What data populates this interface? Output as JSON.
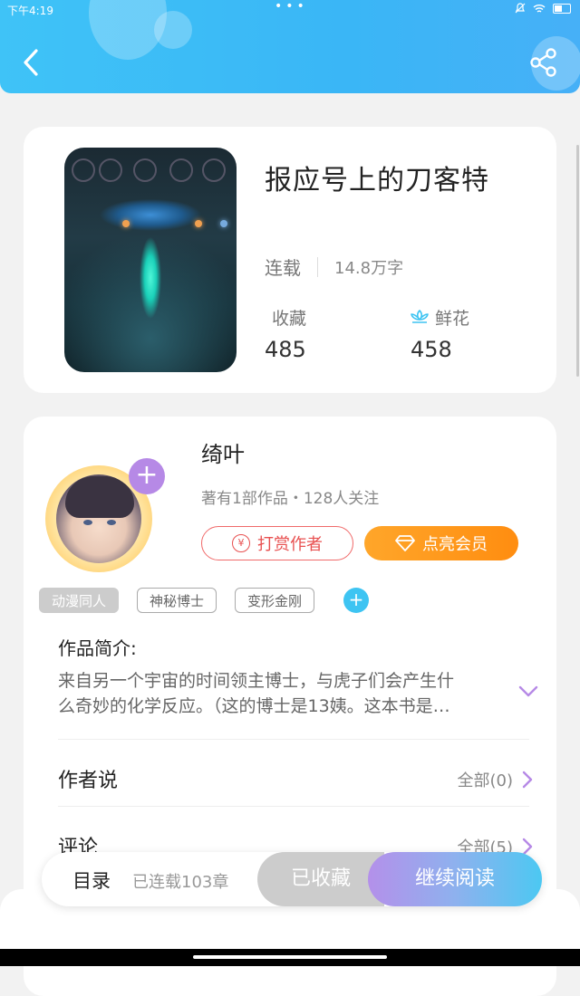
{
  "status_bar": {
    "time": "下午4:19",
    "dots": "•••"
  },
  "book": {
    "title": "报应号上的刀客特",
    "status": "连载",
    "word_count": "14.8万字",
    "favorites_label": "收藏",
    "favorites_value": "485",
    "flowers_label": "鲜花",
    "flowers_value": "458"
  },
  "author": {
    "name": "绮叶",
    "meta": "著有1部作品・128人关注",
    "tip_label": "打赏作者",
    "vip_label": "点亮会员",
    "tags": [
      "动漫同人",
      "神秘博士",
      "变形金刚"
    ]
  },
  "intro": {
    "title": "作品简介:",
    "text": "来自另一个宇宙的时间领主博士，与虎子们会产生什么奇妙的化学反应。（这的博士是13姨。这本书是…"
  },
  "rows": {
    "author_says_label": "作者说",
    "author_says_count": "全部(0)",
    "comments_label": "评论",
    "comments_count": "全部(5)"
  },
  "bottom_bar": {
    "toc_label": "目录",
    "toc_meta": "已连载103章",
    "collected_label": "已收藏",
    "continue_label": "继续阅读"
  },
  "colors": {
    "header": "#3fc3f7",
    "accent_purple": "#b689e6",
    "tip_red": "#e85050",
    "vip_orange": "#ff8d10",
    "flower_blue": "#3ec4f2"
  }
}
